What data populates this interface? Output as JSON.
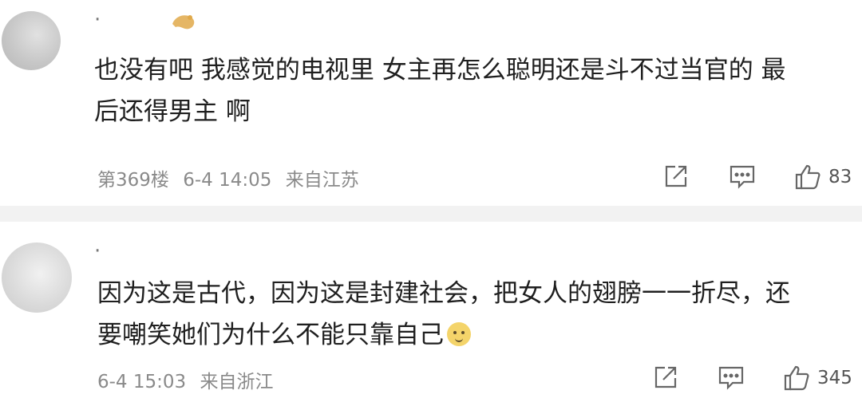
{
  "comments": [
    {
      "username": "·",
      "text_line1": "也没有吧 我感觉的电视里 女主再怎么聪明还是斗不过当官的 最",
      "text_line2": "后还得男主 啊",
      "floor": "第369楼",
      "time": "6-4 14:05",
      "location": "来自江苏",
      "like_count": "83",
      "icons": [
        "avatar",
        "share-icon",
        "comment-icon",
        "thumbs-up-icon"
      ]
    },
    {
      "username": "·",
      "text_line1": "因为这是古代，因为这是封建社会，把女人的翅膀一一折尽，还",
      "text_line2": "要嘲笑她们为什么不能只靠自己",
      "time": "6-4 15:03",
      "location": "来自浙江",
      "like_count": "345",
      "icons": [
        "avatar",
        "emoji-icon",
        "share-icon",
        "comment-icon",
        "thumbs-up-icon"
      ]
    }
  ],
  "colors": {
    "text": "#1f1f1f",
    "meta": "#8a8a8a",
    "divider": "#f2f2f2",
    "badge": "#e0a94a"
  }
}
